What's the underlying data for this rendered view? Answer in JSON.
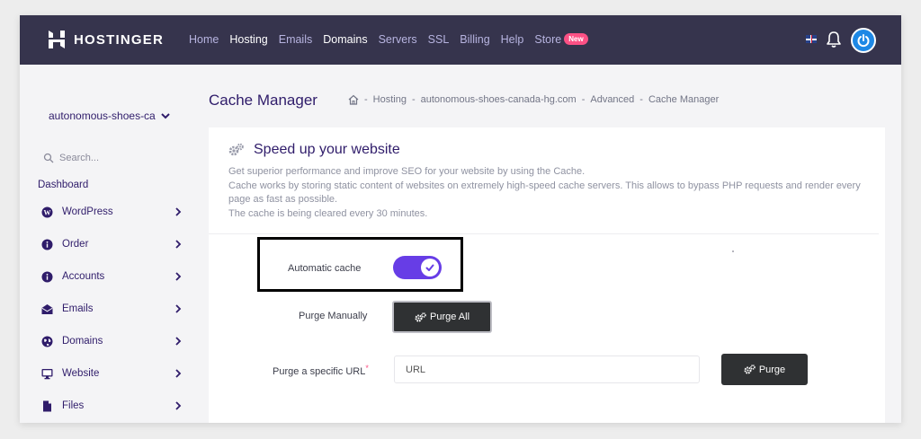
{
  "brand": {
    "name": "HOSTINGER"
  },
  "nav": {
    "items": [
      {
        "label": "Home",
        "bold": false
      },
      {
        "label": "Hosting",
        "bold": true
      },
      {
        "label": "Emails",
        "bold": false
      },
      {
        "label": "Domains",
        "bold": true
      },
      {
        "label": "Servers",
        "bold": false
      },
      {
        "label": "SSL",
        "bold": false
      },
      {
        "label": "Billing",
        "bold": false
      },
      {
        "label": "Help",
        "bold": false
      },
      {
        "label": "Store",
        "bold": false
      }
    ],
    "store_badge": "New"
  },
  "sidebar": {
    "site_name": "autonomous-shoes-ca",
    "search_placeholder": "Search...",
    "section_label": "Dashboard",
    "items": [
      {
        "label": "WordPress",
        "icon": "wordpress-icon"
      },
      {
        "label": "Order",
        "icon": "info-circle-icon"
      },
      {
        "label": "Accounts",
        "icon": "info-circle-icon"
      },
      {
        "label": "Emails",
        "icon": "envelope-open-icon"
      },
      {
        "label": "Domains",
        "icon": "globe-icon"
      },
      {
        "label": "Website",
        "icon": "monitor-icon"
      },
      {
        "label": "Files",
        "icon": "file-icon"
      }
    ]
  },
  "page": {
    "title": "Cache Manager",
    "breadcrumb": [
      "Hosting",
      "autonomous-shoes-canada-hg.com",
      "Advanced",
      "Cache Manager"
    ]
  },
  "card": {
    "title": "Speed up your website",
    "desc_lines": [
      "Get superior performance and improve SEO for your website by using the Cache.",
      "Cache works by storing static content of websites on extremely high-speed cache servers. This allows to bypass PHP requests and render every page as fast as possible.",
      "The cache is being cleared every 30 minutes."
    ],
    "automatic_cache_label": "Automatic cache",
    "automatic_cache_enabled": true,
    "purge_manually_label": "Purge Manually",
    "purge_all_label": "Purge All",
    "purge_url_label": "Purge a specific URL",
    "required_mark": "*",
    "url_placeholder": "URL",
    "purge_label": "Purge"
  },
  "colors": {
    "topbar": "#36344d",
    "accent": "#673de6",
    "badge": "#fc5185",
    "dark_button": "#2f3133",
    "text_primary": "#2f1c6a"
  }
}
